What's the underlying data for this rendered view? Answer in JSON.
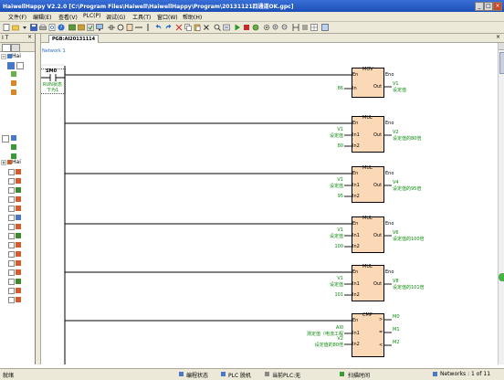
{
  "window": {
    "title": "HaiwellHappy V2.2.0 [C:\\Program Files\\Haiwell\\HaiwellHappy\\Program\\20131121四通道OK.gpc]"
  },
  "menu": [
    "文件(F)",
    "编辑(E)",
    "查看(V)",
    "PLC(P)",
    "调试(G)",
    "工具(T)",
    "窗口(W)",
    "帮助(H)"
  ],
  "left_panel": {
    "header": "I T",
    "tree": [
      {
        "label": "Hai"
      },
      {
        "label": "Hai"
      }
    ]
  },
  "doc_tab": "PGB:AI20131114",
  "network": {
    "label": "Network 1"
  },
  "contact": {
    "name": "SM0",
    "comment_line1": "RUN状态",
    "comment_line2": "下为1"
  },
  "blocks": [
    {
      "name": "MOV",
      "en": "En",
      "eno": "Eno",
      "inputs": [
        {
          "pin": "In",
          "value": "86",
          "comment": ""
        }
      ],
      "outputs": [
        {
          "pin": "Out",
          "value": "V1",
          "comment": "设定值"
        }
      ]
    },
    {
      "name": "MUL",
      "en": "En",
      "eno": "Eno",
      "inputs": [
        {
          "pin": "In1",
          "value": "V1",
          "comment": "设定值"
        },
        {
          "pin": "In2",
          "value": "80",
          "comment": ""
        }
      ],
      "outputs": [
        {
          "pin": "Out",
          "value": "V2",
          "comment": "设定值的80倍"
        }
      ]
    },
    {
      "name": "MUL",
      "en": "En",
      "eno": "Eno",
      "inputs": [
        {
          "pin": "In1",
          "value": "V1",
          "comment": "设定值"
        },
        {
          "pin": "In2",
          "value": "95",
          "comment": ""
        }
      ],
      "outputs": [
        {
          "pin": "Out",
          "value": "V4",
          "comment": "设定值的95倍"
        }
      ]
    },
    {
      "name": "MUL",
      "en": "En",
      "eno": "Eno",
      "inputs": [
        {
          "pin": "In1",
          "value": "V1",
          "comment": "设定值"
        },
        {
          "pin": "In2",
          "value": "100",
          "comment": ""
        }
      ],
      "outputs": [
        {
          "pin": "Out",
          "value": "V6",
          "comment": "设定值的100倍"
        }
      ]
    },
    {
      "name": "MUL",
      "en": "En",
      "eno": "Eno",
      "inputs": [
        {
          "pin": "In1",
          "value": "V1",
          "comment": "设定值"
        },
        {
          "pin": "In2",
          "value": "101",
          "comment": ""
        }
      ],
      "outputs": [
        {
          "pin": "Out",
          "value": "V8",
          "comment": "设定值的101倍"
        }
      ]
    },
    {
      "name": "CMP",
      "en": "En",
      "eno": "",
      "inputs": [
        {
          "pin": "In1",
          "value": "AI0",
          "comment": "测定值（电流工程"
        },
        {
          "pin": "In2",
          "value": "V2",
          "comment": "设定值的80倍"
        }
      ],
      "outputs": [
        {
          "pin": ">",
          "value": "M0",
          "comment": ""
        },
        {
          "pin": "=",
          "value": "M1",
          "comment": ""
        },
        {
          "pin": "<",
          "value": "M2",
          "comment": ""
        }
      ]
    }
  ],
  "status": {
    "ready": "就绪",
    "mode": "编程状态",
    "plc_link": "PLC 脱机",
    "current_plc": "当前PLC:无",
    "scan": "扫描时间",
    "networks": "Networks : 1 of 11"
  }
}
